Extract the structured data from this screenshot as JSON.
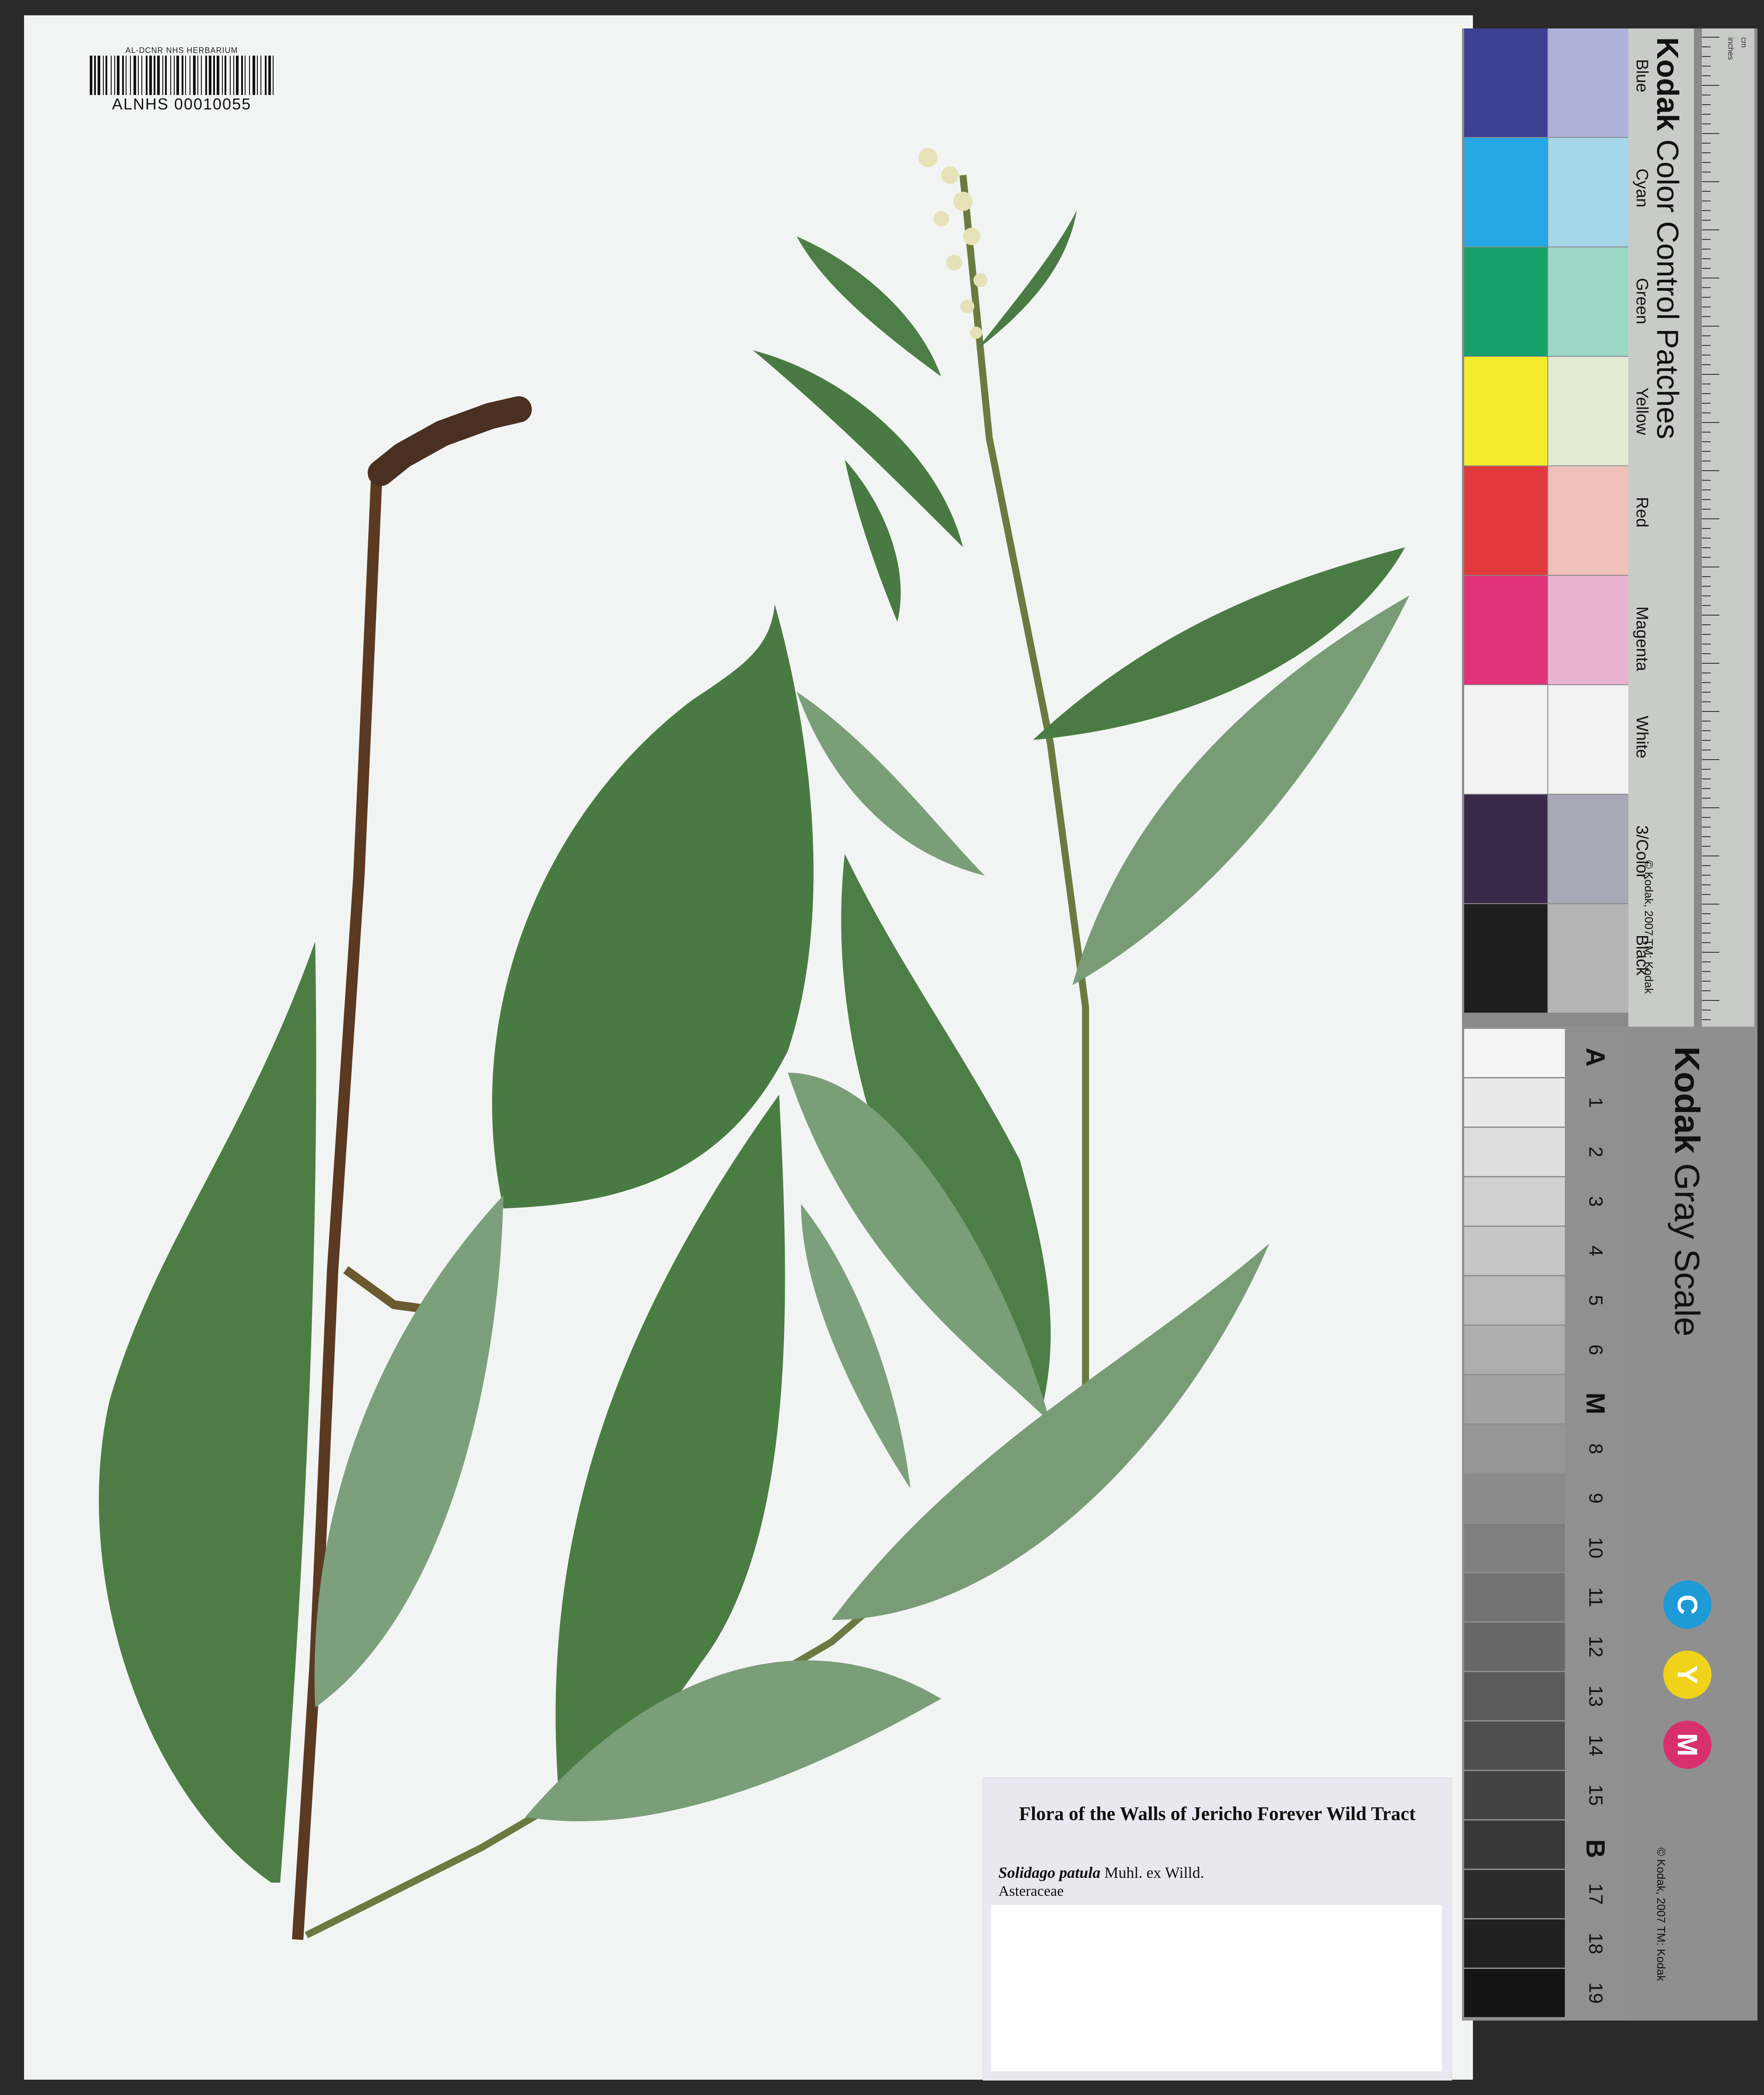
{
  "barcode": {
    "herbarium_line": "AL-DCNR NHS HERBARIUM",
    "catalog_number": "ALNHS 00010055"
  },
  "label": {
    "title": "Flora of the Walls of Jericho Forever Wild Tract",
    "species": "Solidago patula",
    "authority": "Muhl. ex Willd.",
    "family": "Asteraceae"
  },
  "color_card": {
    "brand": "Kodak",
    "title": "Color Control Patches",
    "copyright": "© Kodak, 2007 TM: Kodak",
    "patches": [
      {
        "name": "Blue",
        "dark": "#3d3f93",
        "light": "#aeb2d8"
      },
      {
        "name": "Cyan",
        "dark": "#26a8e4",
        "light": "#a6d6ea"
      },
      {
        "name": "Green",
        "dark": "#16a06a",
        "light": "#9cd6c4"
      },
      {
        "name": "Yellow",
        "dark": "#f3ec2a",
        "light": "#e4ead2"
      },
      {
        "name": "Red",
        "dark": "#e23a3a",
        "light": "#f0c0bb"
      },
      {
        "name": "Magenta",
        "dark": "#e1327a",
        "light": "#e9b4cf"
      },
      {
        "name": "White",
        "dark": "#f2f2f2",
        "light": "#f2f2f2"
      },
      {
        "name": "3/Color",
        "dark": "#3a2a4a",
        "light": "#a9a8b6"
      },
      {
        "name": "Black",
        "dark": "#1e1e1e",
        "light": "#b4b4b4"
      }
    ],
    "ruler_units": [
      "inches",
      "cm"
    ]
  },
  "gray_card": {
    "brand": "Kodak",
    "title": "Gray Scale",
    "copyright": "© Kodak, 2007 TM: Kodak",
    "steps": [
      "A",
      "1",
      "2",
      "3",
      "4",
      "5",
      "6",
      "M",
      "8",
      "9",
      "10",
      "11",
      "12",
      "13",
      "14",
      "15",
      "B",
      "17",
      "18",
      "19"
    ],
    "cym": [
      {
        "letter": "C",
        "color": "#1e9ad6"
      },
      {
        "letter": "Y",
        "color": "#f1d21a"
      },
      {
        "letter": "M",
        "color": "#d8306e"
      }
    ]
  },
  "colors": {
    "leaf": "#4a7a43",
    "leaf_pale": "#6f9670",
    "stem": "#5a3a22",
    "sheet": "#f2f4f3",
    "label_bg": "#e9e8f0"
  }
}
